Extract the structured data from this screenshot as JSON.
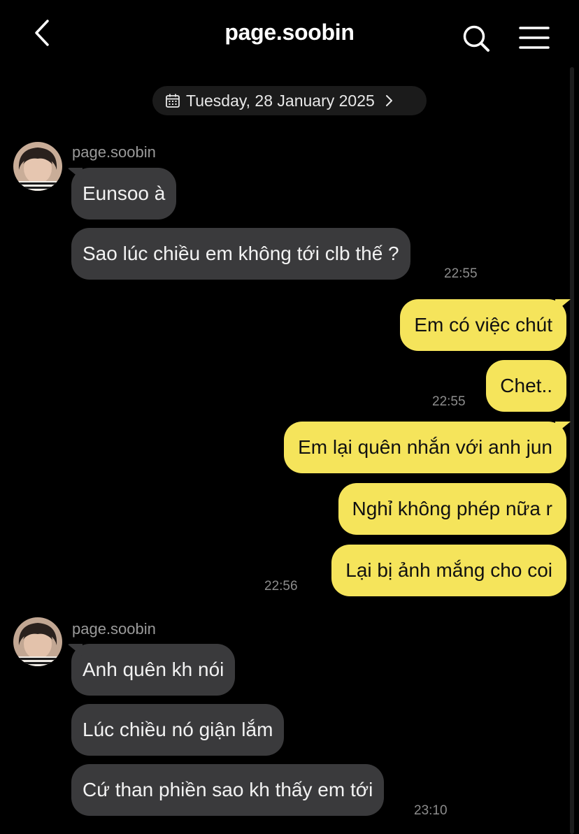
{
  "header": {
    "title": "page.soobin",
    "back_icon": "chevron-left-icon",
    "search_icon": "search-icon",
    "menu_icon": "hamburger-menu-icon"
  },
  "date_pill": {
    "label": "Tuesday, 28 January 2025",
    "icon": "calendar-icon"
  },
  "colors": {
    "background": "#000000",
    "incoming_bubble": "#3a3a3c",
    "outgoing_bubble": "#f5e45b",
    "timestamp": "#8c8c8c"
  },
  "groups": [
    {
      "sender": "page.soobin",
      "messages": [
        "Eunsoo à",
        "Sao lúc chiều em không tới clb thế ?"
      ],
      "time": "22:55"
    },
    {
      "messages": [
        "Em có việc chút",
        "Chet.."
      ],
      "time": "22:55"
    },
    {
      "messages": [
        "Em lại quên nhắn với anh jun",
        "Nghỉ không phép nữa r",
        "Lại bị ảnh mắng cho coi"
      ],
      "time": "22:56"
    },
    {
      "sender": "page.soobin",
      "messages": [
        "Anh quên kh nói",
        "Lúc chiều nó giận lắm",
        "Cứ than phiền sao kh thấy em tới"
      ],
      "time": "23:10"
    }
  ]
}
